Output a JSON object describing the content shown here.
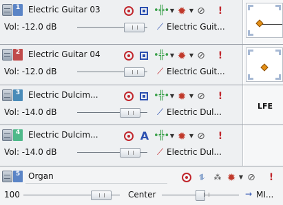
{
  "tracks": [
    {
      "number": "1",
      "number_color": "#5a84c6",
      "name": "Electric Guitar 03",
      "volume": "Vol: -12.0 dB",
      "volume_fader": 0.52,
      "output": "Electric Guit...",
      "auto_button": "monitor",
      "panner": "surround",
      "panner_diamond_x": 0.36,
      "panner_diamond_y": 0.55
    },
    {
      "number": "2",
      "number_color": "#c04a4a",
      "name": "Electric Guitar 04",
      "volume": "Vol: -12.0 dB",
      "volume_fader": 0.52,
      "output": "Electric Guit...",
      "auto_button": "monitor",
      "panner": "surround",
      "panner_diamond_x": 0.45,
      "panner_diamond_y": 0.55
    },
    {
      "number": "3",
      "number_color": "#4a8bb8",
      "name": "Electric Dulcim...",
      "volume": "Vol: -14.0 dB",
      "volume_fader": 0.45,
      "output": "Electric Dul...",
      "auto_button": "monitor",
      "panner": "lfe",
      "side_label": "LFE"
    },
    {
      "number": "4",
      "number_color": "#4fb98a",
      "name": "Electric Dulcim...",
      "volume": "Vol: -14.0 dB",
      "volume_fader": 0.45,
      "output": "Electric Dul...",
      "auto_button": "automation",
      "auto_label": "A",
      "panner": "none"
    }
  ],
  "bus": {
    "number": "5",
    "number_color": "#5a84c6",
    "name": "Organ",
    "volume": "100",
    "pan": "Center",
    "output": "MI...",
    "output_icon": "→"
  },
  "colors": {
    "record": "#c1272d",
    "monitor": "#2b4fb0",
    "routing": "#3aa04a",
    "fx": "#c0392b"
  },
  "icons": {
    "track": "track-icon",
    "record": "record-arm-icon",
    "monitor": "input-monitor-icon",
    "automation": "automation-icon",
    "routing": "insert-routing-icon",
    "fx": "fx-icon",
    "mute": "no-entry-icon",
    "solo": "exclamation-icon",
    "output": "output-icon"
  }
}
